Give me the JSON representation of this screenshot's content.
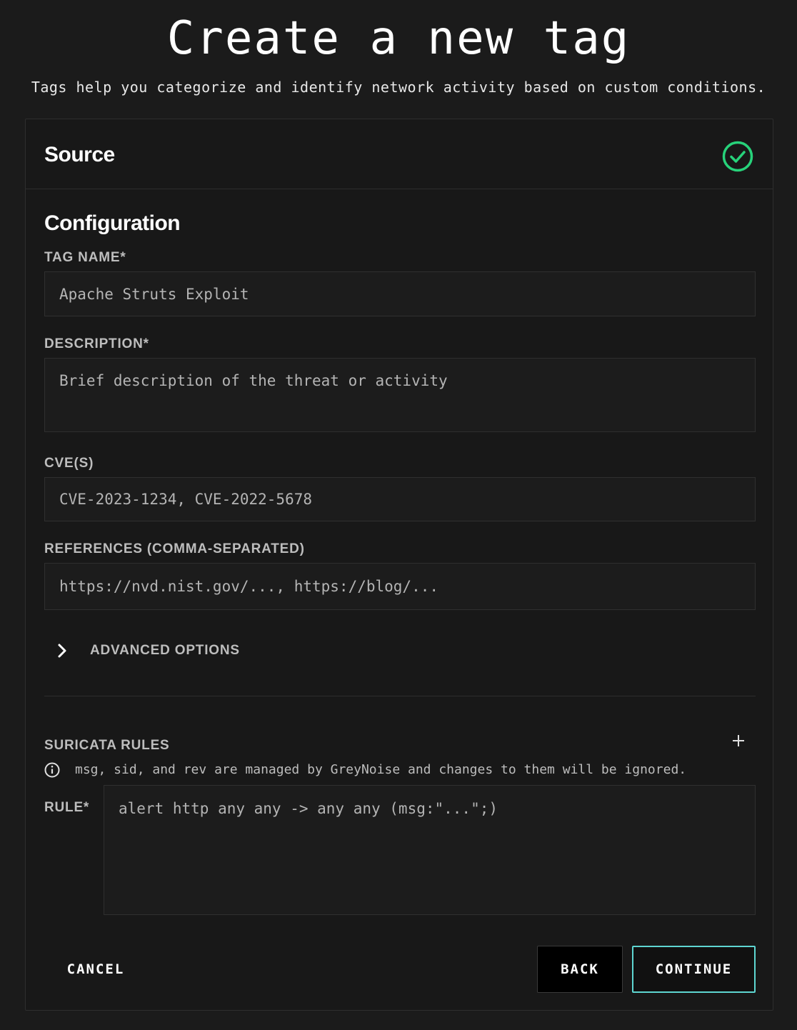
{
  "page": {
    "title": "Create a new tag",
    "subtitle": "Tags help you categorize and identify network activity based on custom conditions."
  },
  "source_section": {
    "title": "Source",
    "status_icon": "check-circle-icon",
    "status_color": "#27d27a"
  },
  "configuration": {
    "title": "Configuration",
    "fields": {
      "tag_name": {
        "label": "TAG NAME*",
        "placeholder": "Apache Struts Exploit",
        "value": ""
      },
      "description": {
        "label": "DESCRIPTION*",
        "placeholder": "Brief description of the threat or activity",
        "value": ""
      },
      "cves": {
        "label": "CVE(S)",
        "placeholder": "CVE-2023-1234, CVE-2022-5678",
        "value": ""
      },
      "references": {
        "label": "REFERENCES (COMMA-SEPARATED)",
        "placeholder": "https://nvd.nist.gov/..., https://blog/...",
        "value": ""
      }
    },
    "advanced_options": {
      "label": "ADVANCED OPTIONS",
      "icon": "chevron-right-icon",
      "expanded": false
    }
  },
  "suricata": {
    "title": "SURICATA RULES",
    "add_icon": "plus-icon",
    "info_icon": "info-icon",
    "info_text": "msg, sid, and rev are managed by GreyNoise and changes to them will be ignored.",
    "rule": {
      "label": "RULE*",
      "placeholder": "alert http any any -> any any (msg:\"...\";)",
      "value": ""
    }
  },
  "actions": {
    "cancel_label": "CANCEL",
    "back_label": "BACK",
    "continue_label": "CONTINUE",
    "continue_border_color": "#5ed6d2"
  }
}
